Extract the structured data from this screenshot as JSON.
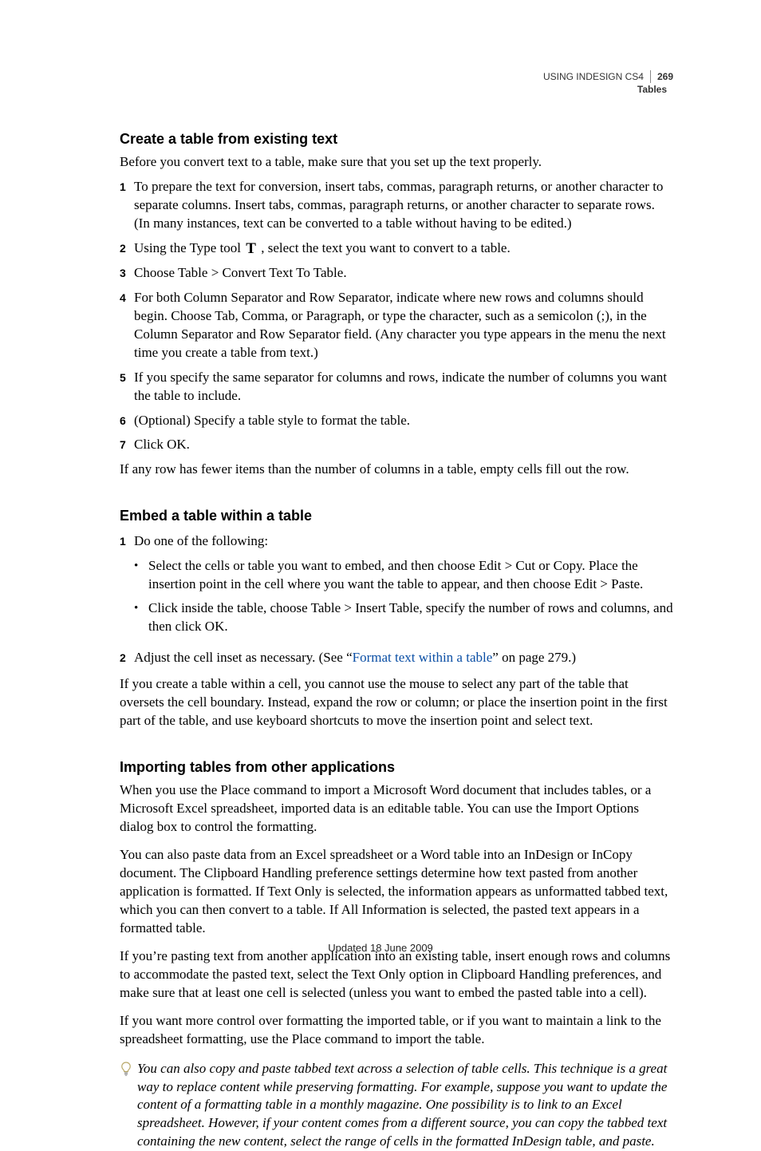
{
  "running_header": {
    "title": "USING INDESIGN CS4",
    "page_number": "269",
    "section": "Tables"
  },
  "section1": {
    "heading": "Create a table from existing text",
    "intro": "Before you convert text to a table, make sure that you set up the text properly.",
    "step1": "To prepare the text for conversion, insert tabs, commas, paragraph returns, or another character to separate columns. Insert tabs, commas, paragraph returns, or another character to separate rows. (In many instances, text can be converted to a table without having to be edited.)",
    "step2_a": "Using the Type tool ",
    "step2_b": " , select the text you want to convert to a table.",
    "step3": "Choose Table > Convert Text To Table.",
    "step4": "For both Column Separator and Row Separator, indicate where new rows and columns should begin. Choose Tab, Comma, or Paragraph, or type the character, such as a semicolon (;), in the Column Separator and Row Separator field. (Any character you type appears in the menu the next time you create a table from text.)",
    "step5": "If you specify the same separator for columns and rows, indicate the number of columns you want the table to include.",
    "step6": "(Optional) Specify a table style to format the table.",
    "step7": "Click OK.",
    "after": "If any row has fewer items than the number of columns in a table, empty cells fill out the row."
  },
  "section2": {
    "heading": "Embed a table within a table",
    "step1": "Do one of the following:",
    "bullet1": "Select the cells or table you want to embed, and then choose Edit > Cut or Copy. Place the insertion point in the cell where you want the table to appear, and then choose Edit > Paste.",
    "bullet2": "Click inside the table, choose Table > Insert Table, specify the number of rows and columns, and then click OK.",
    "step2_a": "Adjust the cell inset as necessary. (See “",
    "step2_link": "Format text within a table",
    "step2_b": "” on page 279.)",
    "after": "If you create a table within a cell, you cannot use the mouse to select any part of the table that oversets the cell boundary. Instead, expand the row or column; or place the insertion point in the first part of the table, and use keyboard shortcuts to move the insertion point and select text."
  },
  "section3": {
    "heading": "Importing tables from other applications",
    "p1": "When you use the Place command to import a Microsoft Word document that includes tables, or a Microsoft Excel spreadsheet, imported data is an editable table. You can use the Import Options dialog box to control the formatting.",
    "p2": "You can also paste data from an Excel spreadsheet or a Word table into an InDesign or InCopy document. The Clipboard Handling preference settings determine how text pasted from another application is formatted. If Text Only is selected, the information appears as unformatted tabbed text, which you can then convert to a table. If All Information is selected, the pasted text appears in a formatted table.",
    "p3": "If you’re pasting text from another application into an existing table, insert enough rows and columns to accommodate the pasted text, select the Text Only option in Clipboard Handling preferences, and make sure that at least one cell is selected (unless you want to embed the pasted table into a cell).",
    "p4": "If you want more control over formatting the imported table, or if you want to maintain a link to the spreadsheet formatting, use the Place command to import the table.",
    "tip": "You can also copy and paste tabbed text across a selection of table cells. This technique is a great way to replace content while preserving formatting. For example, suppose you want to update the content of a formatting table in a monthly magazine. One possibility is to link to an Excel spreadsheet. However, if your content comes from a different source, you can copy the tabbed text containing the new content, select the range of cells in the formatted InDesign table, and paste."
  },
  "footer": "Updated 18 June 2009"
}
